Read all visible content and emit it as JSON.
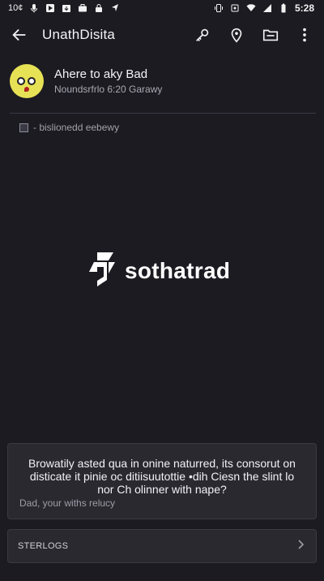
{
  "status_bar": {
    "left_label": "10¢",
    "icons_left": [
      "mic-icon",
      "play-store-icon",
      "download-icon",
      "briefcase-icon",
      "lock-icon",
      "navigation-icon"
    ],
    "icons_right": [
      "vibrate-icon",
      "signal-vibe-icon",
      "wifi-icon",
      "signal-icon",
      "battery-icon"
    ],
    "time": "5:28"
  },
  "app_bar": {
    "title": "UnathDisita",
    "actions": [
      "key-icon",
      "location-pin-icon",
      "folder-icon",
      "more-vert-icon"
    ]
  },
  "profile": {
    "name": "Ahere to aky Bad",
    "subtitle": "Noundsrfrlo 6:20 Garawy"
  },
  "meta": {
    "text": "- bislionedd eebewy"
  },
  "brand": {
    "name": "sothatrad"
  },
  "card": {
    "text": "Browatily asted qua in onine naturred, its consorut on disticate it pinie oc ditiisuutottie •dih Ciesn the slint lo nor Ch olinner with nape?",
    "hint": "Dad, your withs relucy"
  },
  "bottom_button": {
    "label": "STERLOGS"
  },
  "colors": {
    "background": "#1c1b22",
    "card": "#2a2930",
    "avatar": "#e7e255"
  }
}
